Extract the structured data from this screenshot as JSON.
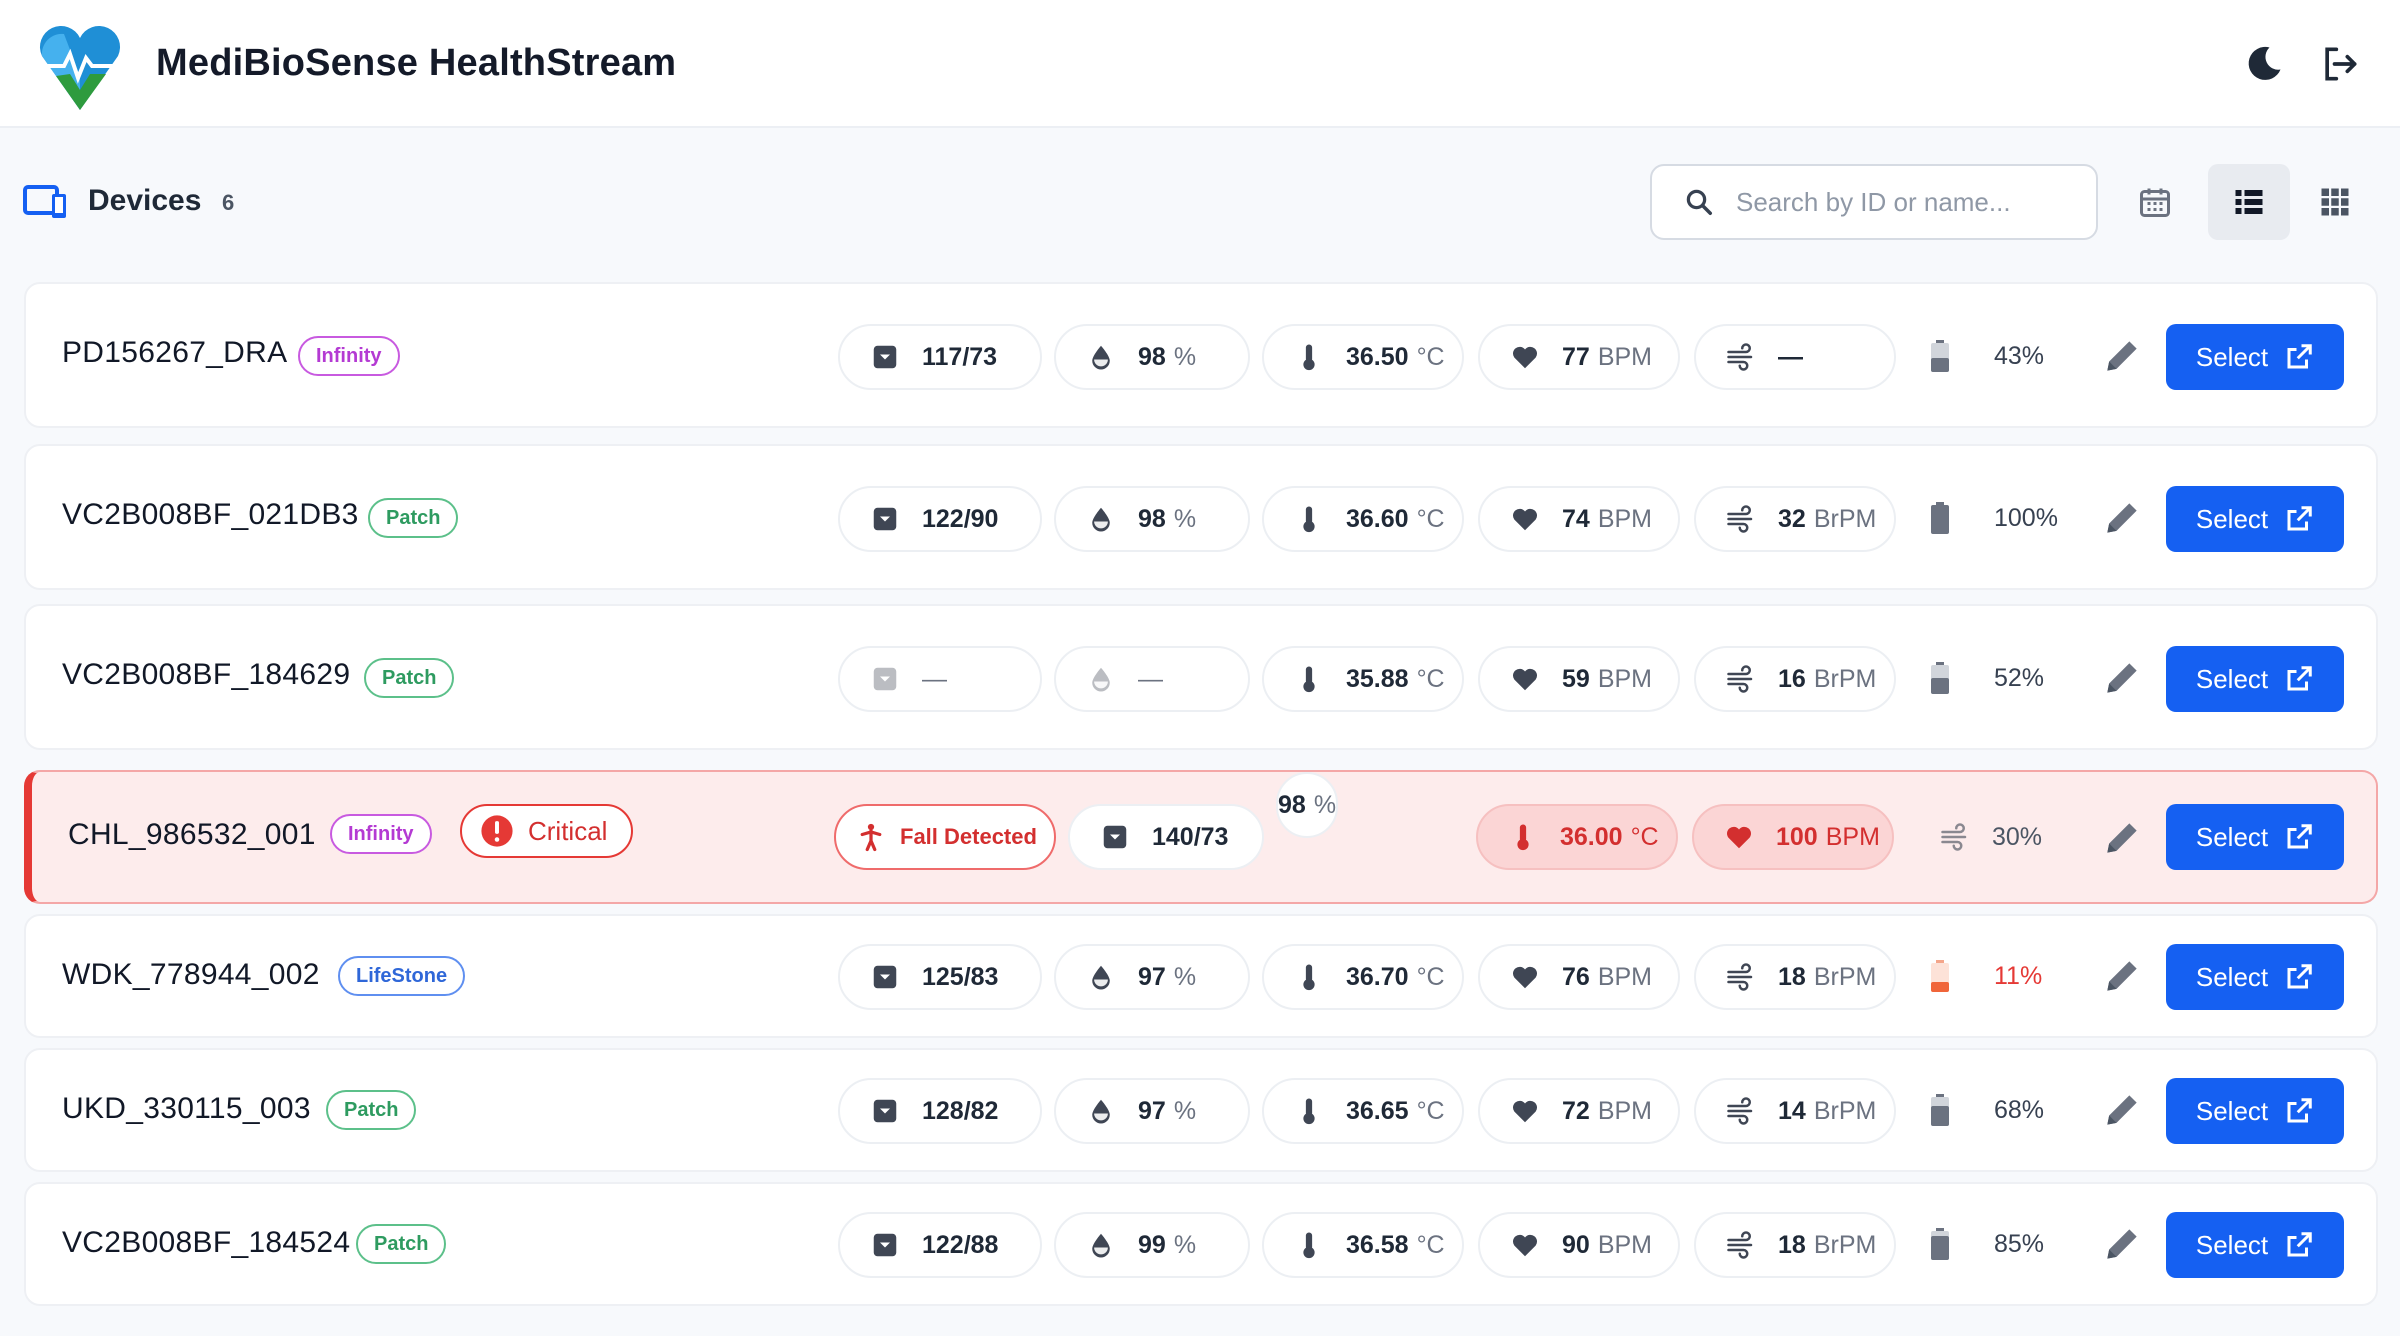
{
  "app": {
    "title": "MediBioSense HealthStream"
  },
  "header": {
    "theme_icon": "moon-icon",
    "logout_icon": "logout-icon"
  },
  "toolbar": {
    "label": "Devices",
    "count": "6",
    "search_placeholder": "Search by ID or name...",
    "calendar_icon": "calendar-icon",
    "list_view_icon": "list-view-icon",
    "grid_view_icon": "grid-view-icon",
    "active_view": "list"
  },
  "select_label": "Select",
  "critical_label": "Critical",
  "fall_label": "Fall Detected",
  "units": {
    "spo2": "%",
    "temp": "°C",
    "hr": "BPM",
    "rr": "BrPM"
  },
  "colors": {
    "primary": "#1560f2",
    "critical": "#e53935",
    "patch": "#2e9b60",
    "infinity": "#b43ad3",
    "lifestone": "#2f67d8"
  },
  "devices": [
    {
      "id": "PD156267_DRA",
      "tag": "Infinity",
      "bp": "117/73",
      "spo2": "98",
      "temp": "36.50",
      "hr": "77",
      "rr": "—",
      "battery": "43%"
    },
    {
      "id": "VC2B008BF_021DB3",
      "tag": "Patch",
      "bp": "122/90",
      "spo2": "98",
      "temp": "36.60",
      "hr": "74",
      "rr": "32",
      "battery": "100%"
    },
    {
      "id": "VC2B008BF_184629",
      "tag": "Patch",
      "bp": "—",
      "spo2": "—",
      "temp": "35.88",
      "hr": "59",
      "rr": "16",
      "battery": "52%"
    },
    {
      "id": "CHL_986532_001",
      "tag": "Infinity",
      "critical": true,
      "fall": true,
      "bp": "140/73",
      "spo2": "98",
      "temp": "36.00",
      "hr": "100",
      "rr": "30%"
    },
    {
      "id": "WDK_778944_002",
      "tag": "LifeStone",
      "bp": "125/83",
      "spo2": "97",
      "temp": "36.70",
      "hr": "76",
      "rr": "18",
      "battery": "11%"
    },
    {
      "id": "UKD_330115_003",
      "tag": "Patch",
      "bp": "128/82",
      "spo2": "97",
      "temp": "36.65",
      "hr": "72",
      "rr": "14",
      "battery": "68%"
    },
    {
      "id": "VC2B008BF_184524",
      "tag": "Patch",
      "bp": "122/88",
      "spo2": "99",
      "temp": "36.58",
      "hr": "90",
      "rr": "18",
      "battery": "85%"
    }
  ]
}
